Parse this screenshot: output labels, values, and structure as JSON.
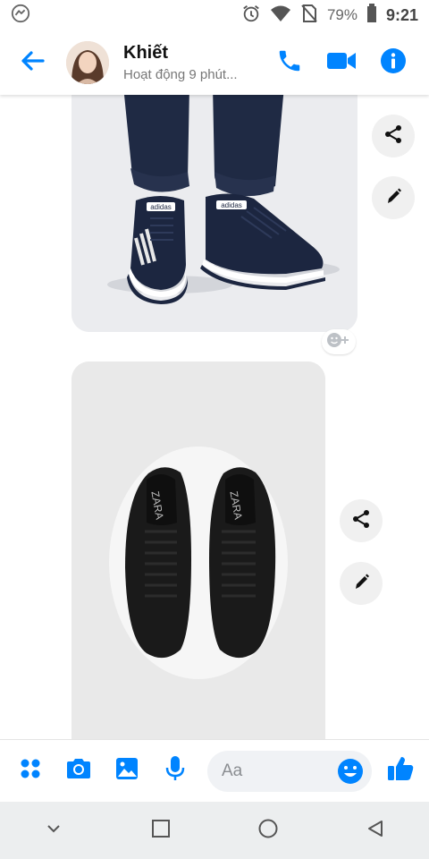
{
  "status_bar": {
    "battery_percent": "79%",
    "time": "9:21",
    "icons": [
      "messenger-icon",
      "alarm-icon",
      "wifi-icon",
      "no-sim-icon",
      "battery-icon"
    ]
  },
  "header": {
    "contact_name": "Khiết",
    "contact_status": "Hoạt động 9 phút...",
    "icons": [
      "back-arrow-icon",
      "phone-icon",
      "video-camera-icon",
      "info-icon"
    ]
  },
  "messages": [
    {
      "type": "image",
      "description_icon": "adidas-shoes-photo"
    },
    {
      "type": "image",
      "description_icon": "zara-shoes-photo"
    }
  ],
  "composer": {
    "placeholder": "Aa",
    "icons": [
      "apps-grid-icon",
      "camera-icon",
      "gallery-icon",
      "microphone-icon",
      "emoji-icon",
      "thumbs-up-icon"
    ]
  },
  "navbar": {
    "icons": [
      "chevron-down-icon",
      "recents-square-icon",
      "home-circle-icon",
      "back-triangle-icon"
    ]
  },
  "colors": {
    "accent": "#0084ff",
    "header_bg": "#ffffff",
    "image_bg": "#e9ebee",
    "nav_bg": "#eceeef"
  }
}
